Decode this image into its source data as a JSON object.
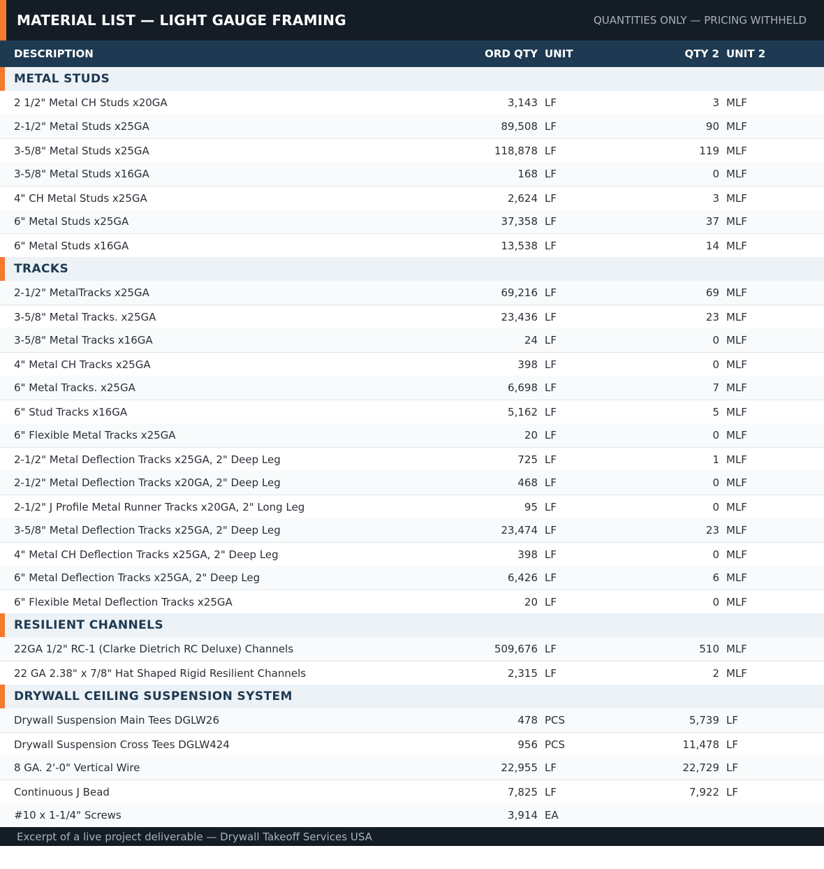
{
  "header": {
    "title": "MATERIAL LIST — LIGHT GAUGE FRAMING",
    "subtitle": "QUANTITIES ONLY — PRICING WITHHELD",
    "accent_color": "#f47a2e"
  },
  "columns": {
    "description": "DESCRIPTION",
    "ord_qty": "ORD QTY",
    "unit": "UNIT",
    "qty2": "QTY 2",
    "unit2": "UNIT 2"
  },
  "sections": [
    {
      "title": "METAL STUDS",
      "rows": [
        {
          "desc": "2 1/2\" Metal CH Studs x20GA",
          "ord_qty": "3,143",
          "unit": "LF",
          "qty2": "3",
          "unit2": "MLF"
        },
        {
          "desc": "2-1/2\" Metal Studs x25GA",
          "ord_qty": "89,508",
          "unit": "LF",
          "qty2": "90",
          "unit2": "MLF"
        },
        {
          "desc": "3-5/8\" Metal Studs x25GA",
          "ord_qty": "118,878",
          "unit": "LF",
          "qty2": "119",
          "unit2": "MLF"
        },
        {
          "desc": "3-5/8\" Metal Studs x16GA",
          "ord_qty": "168",
          "unit": "LF",
          "qty2": "0",
          "unit2": "MLF"
        },
        {
          "desc": "4\" CH Metal Studs x25GA",
          "ord_qty": "2,624",
          "unit": "LF",
          "qty2": "3",
          "unit2": "MLF"
        },
        {
          "desc": "6\" Metal Studs x25GA",
          "ord_qty": "37,358",
          "unit": "LF",
          "qty2": "37",
          "unit2": "MLF"
        },
        {
          "desc": "6\" Metal Studs x16GA",
          "ord_qty": "13,538",
          "unit": "LF",
          "qty2": "14",
          "unit2": "MLF"
        }
      ]
    },
    {
      "title": "TRACKS",
      "rows": [
        {
          "desc": "2-1/2\" MetalTracks x25GA",
          "ord_qty": "69,216",
          "unit": "LF",
          "qty2": "69",
          "unit2": "MLF"
        },
        {
          "desc": "3-5/8\" Metal Tracks. x25GA",
          "ord_qty": "23,436",
          "unit": "LF",
          "qty2": "23",
          "unit2": "MLF"
        },
        {
          "desc": "3-5/8\" Metal Tracks x16GA",
          "ord_qty": "24",
          "unit": "LF",
          "qty2": "0",
          "unit2": "MLF"
        },
        {
          "desc": "4\" Metal CH Tracks x25GA",
          "ord_qty": "398",
          "unit": "LF",
          "qty2": "0",
          "unit2": "MLF"
        },
        {
          "desc": "6\" Metal Tracks. x25GA",
          "ord_qty": "6,698",
          "unit": "LF",
          "qty2": "7",
          "unit2": "MLF"
        },
        {
          "desc": "6\" Stud Tracks x16GA",
          "ord_qty": "5,162",
          "unit": "LF",
          "qty2": "5",
          "unit2": "MLF"
        },
        {
          "desc": "6\" Flexible Metal Tracks x25GA",
          "ord_qty": "20",
          "unit": "LF",
          "qty2": "0",
          "unit2": "MLF"
        },
        {
          "desc": "2-1/2\" Metal Deflection Tracks x25GA, 2\" Deep Leg",
          "ord_qty": "725",
          "unit": "LF",
          "qty2": "1",
          "unit2": "MLF"
        },
        {
          "desc": "2-1/2\" Metal Deflection Tracks x20GA, 2\" Deep Leg",
          "ord_qty": "468",
          "unit": "LF",
          "qty2": "0",
          "unit2": "MLF"
        },
        {
          "desc": "2-1/2\" J Profile Metal Runner Tracks x20GA, 2\" Long Leg",
          "ord_qty": "95",
          "unit": "LF",
          "qty2": "0",
          "unit2": "MLF"
        },
        {
          "desc": "3-5/8\" Metal Deflection Tracks x25GA, 2\" Deep Leg",
          "ord_qty": "23,474",
          "unit": "LF",
          "qty2": "23",
          "unit2": "MLF"
        },
        {
          "desc": "4\" Metal CH Deflection Tracks x25GA, 2\" Deep Leg",
          "ord_qty": "398",
          "unit": "LF",
          "qty2": "0",
          "unit2": "MLF"
        },
        {
          "desc": "6\" Metal Deflection Tracks x25GA, 2\" Deep Leg",
          "ord_qty": "6,426",
          "unit": "LF",
          "qty2": "6",
          "unit2": "MLF"
        },
        {
          "desc": "6\" Flexible Metal Deflection Tracks x25GA",
          "ord_qty": "20",
          "unit": "LF",
          "qty2": "0",
          "unit2": "MLF"
        }
      ]
    },
    {
      "title": "RESILIENT CHANNELS",
      "rows": [
        {
          "desc": "22GA 1/2\" RC-1 (Clarke Dietrich RC Deluxe) Channels",
          "ord_qty": "509,676",
          "unit": "LF",
          "qty2": "510",
          "unit2": "MLF"
        },
        {
          "desc": "22 GA 2.38\" x 7/8\" Hat Shaped Rigid Resilient Channels",
          "ord_qty": "2,315",
          "unit": "LF",
          "qty2": "2",
          "unit2": "MLF"
        }
      ]
    },
    {
      "title": "DRYWALL CEILING SUSPENSION SYSTEM",
      "rows": [
        {
          "desc": "Drywall Suspension Main Tees DGLW26",
          "ord_qty": "478",
          "unit": "PCS",
          "qty2": "5,739",
          "unit2": "LF"
        },
        {
          "desc": "Drywall Suspension Cross Tees DGLW424",
          "ord_qty": "956",
          "unit": "PCS",
          "qty2": "11,478",
          "unit2": "LF"
        },
        {
          "desc": "8 GA. 2'-0\" Vertical Wire",
          "ord_qty": "22,955",
          "unit": "LF",
          "qty2": "22,729",
          "unit2": "LF"
        },
        {
          "desc": "Continuous J Bead",
          "ord_qty": "7,825",
          "unit": "LF",
          "qty2": "7,922",
          "unit2": "LF"
        },
        {
          "desc": "#10 x 1-1/4\" Screws",
          "ord_qty": "3,914",
          "unit": "EA",
          "qty2": "",
          "unit2": ""
        }
      ]
    }
  ],
  "footer": {
    "text": "Excerpt of a live project deliverable — Drywall Takeoff Services USA"
  }
}
